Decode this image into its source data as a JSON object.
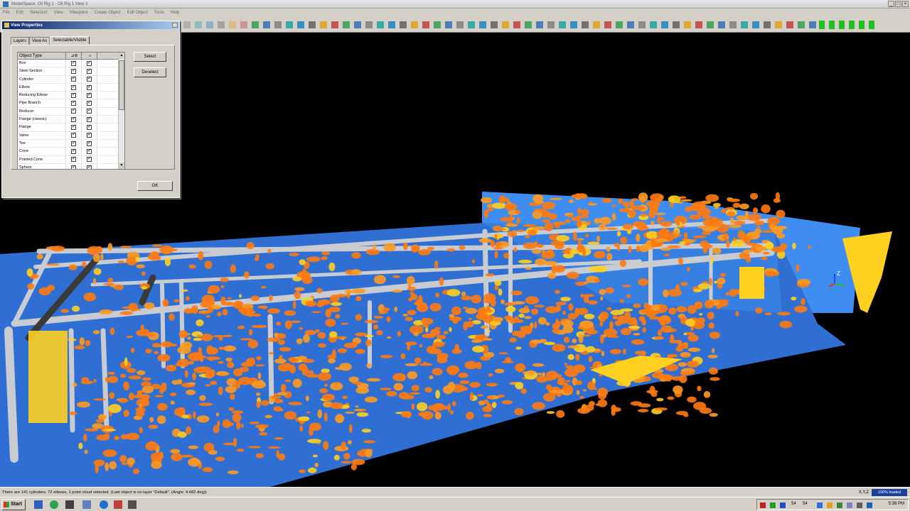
{
  "window": {
    "title": "ModelSpace: Oil Rig 1 - Oil Rig 1 View 1",
    "controls": [
      "_",
      "□",
      "×"
    ]
  },
  "menu": [
    "File",
    "Edit",
    "Selection",
    "View",
    "Viewpoint",
    "Create Object",
    "Edit Object",
    "Tools",
    "Help"
  ],
  "dialog": {
    "title": "View Properties",
    "close_glyph": "×",
    "tabs": [
      "Layers",
      "View As",
      "Selectable/Visible"
    ],
    "active_tab": "Selectable/Visible",
    "columns": [
      "Object Type",
      "⊿⊘",
      "☼"
    ],
    "rows": [
      "Box",
      "Steel Section",
      "Cylinder",
      "Elbow",
      "Reducing Elbow",
      "Pipe Branch",
      "Reducer",
      "Flange (classic)",
      "Flange",
      "Valve",
      "Tee",
      "Cone",
      "Pointed Cone",
      "Sphere"
    ],
    "select_label": "Select",
    "deselect_label": "Deselect",
    "ok_label": "OK"
  },
  "status": {
    "message": "There are 141 cylinders, 72 elbows, 1 point cloud selected. (Last object is on layer \"Default\". (Angle: 4.682 deg))",
    "coords": "X,Y,Z",
    "loaded": "100% loaded"
  },
  "taskbar": {
    "start_label": "Start",
    "clock": "5:38 PM",
    "tray_numbers": [
      "54",
      "54"
    ]
  },
  "axis_labels": {
    "z": "Z"
  },
  "colors": {
    "floor": "#2f6fd3",
    "wall": "#3f8df0",
    "points_orange": "#ff7a10",
    "points_yellow": "#ffd020",
    "pipe": "#c8ccd0",
    "dialog_title": "#0a246a"
  },
  "icons": [
    "save-icon",
    "open-icon",
    "zoom-icon",
    "rotate-icon",
    "pan-icon",
    "measure-icon",
    "layer-icon",
    "cylinder-fit-icon"
  ]
}
